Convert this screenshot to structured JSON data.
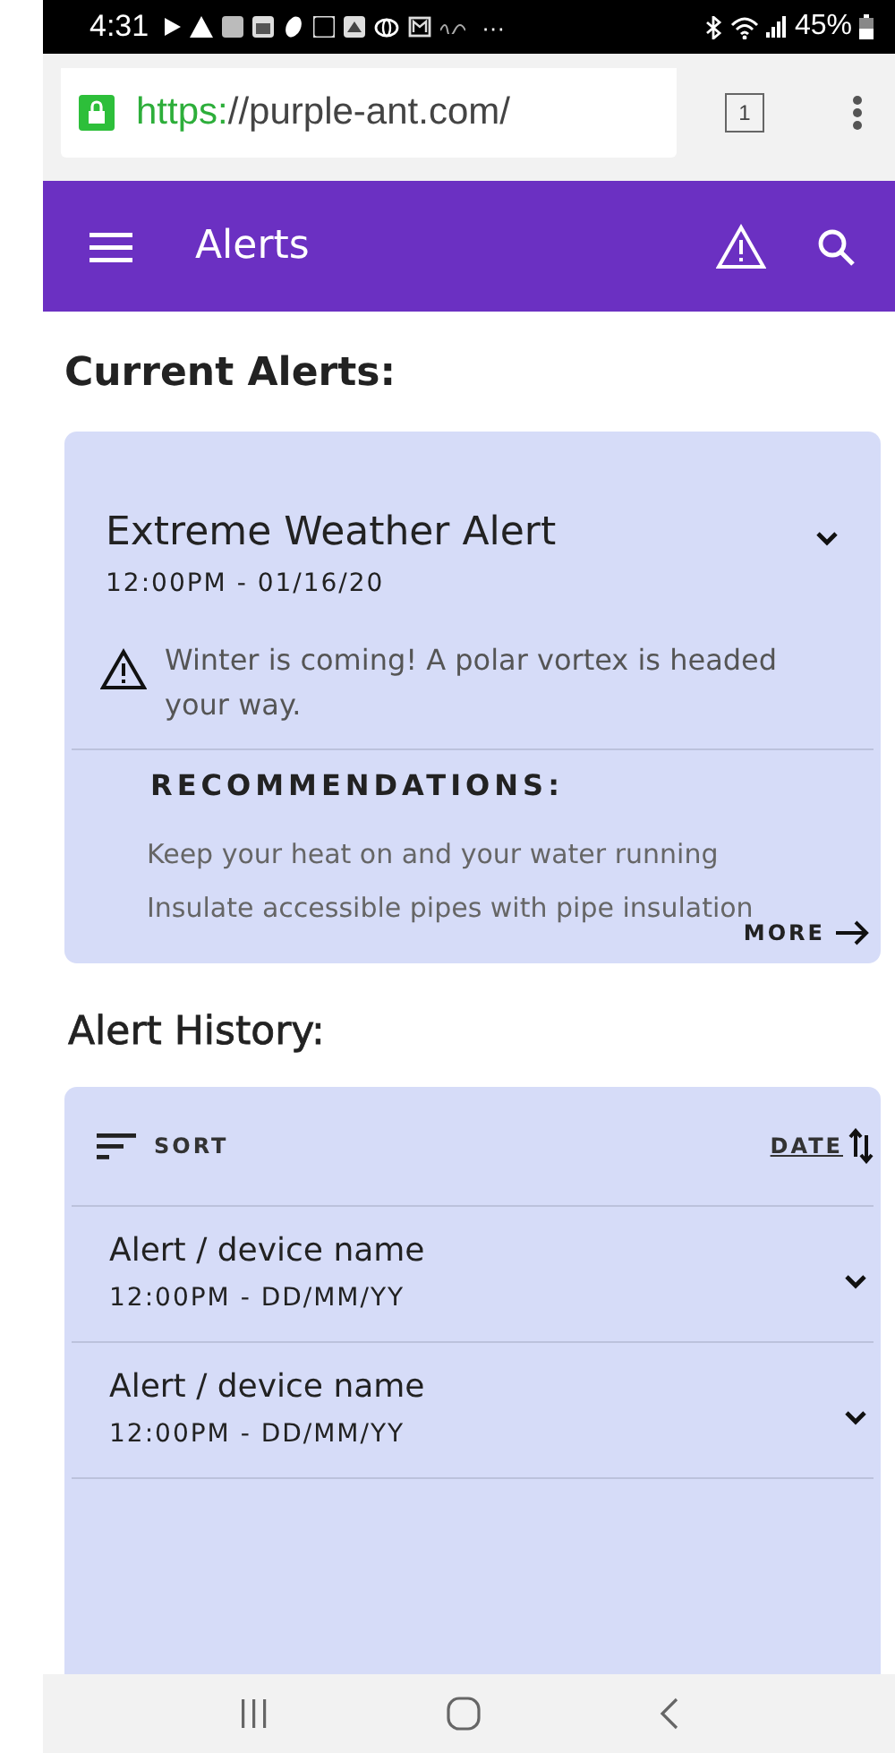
{
  "status_bar": {
    "time": "4:31",
    "more_indicator": "···",
    "battery": "45%"
  },
  "browser": {
    "url_scheme": "https:",
    "url_rest": "//purple-ant.com/",
    "tab_count": "1"
  },
  "app_bar": {
    "title": "Alerts"
  },
  "current": {
    "heading": "Current Alerts:",
    "alert": {
      "title": "Extreme Weather Alert",
      "time": "12:00PM - 01/16/20",
      "message": "Winter is coming! A polar vortex is headed your way.",
      "recommendations_heading": "RECOMMENDATIONS:",
      "recommendations": [
        "Keep your heat on and your water running",
        "Insulate accessible pipes with pipe insulation"
      ],
      "more": "MORE"
    }
  },
  "history": {
    "heading": "Alert History:",
    "sort": "SORT",
    "date": "DATE",
    "items": [
      {
        "title": "Alert / device name",
        "time": "12:00PM - DD/MM/YY"
      },
      {
        "title": "Alert / device name",
        "time": "12:00PM - DD/MM/YY"
      }
    ]
  }
}
